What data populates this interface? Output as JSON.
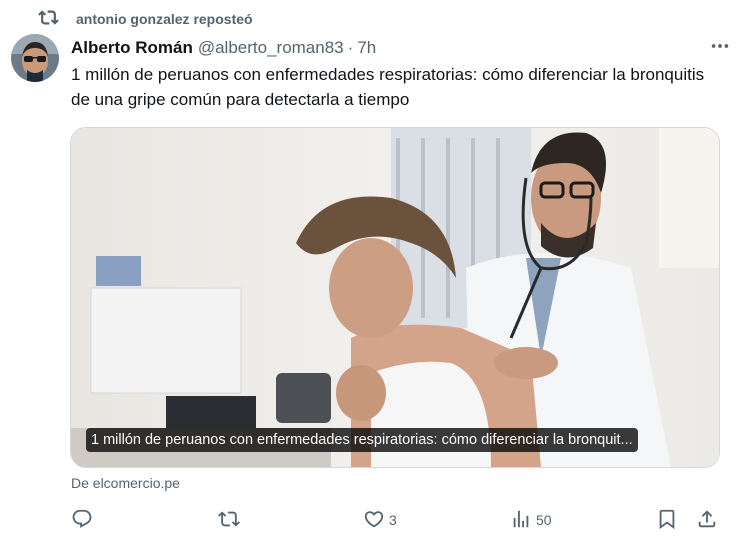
{
  "repost": {
    "text": "antonio gonzalez reposteó",
    "icon": "repost-icon"
  },
  "author": {
    "name": "Alberto Román",
    "handle": "@alberto_roman83",
    "separator": "·",
    "time": "7h"
  },
  "tweet": {
    "text": "1 millón de peruanos con enfermedades respiratorias: cómo diferenciar la bronquitis de una gripe común para detectarla a tiempo"
  },
  "card": {
    "caption": "1 millón de peruanos con enfermedades respiratorias: cómo diferenciar la bronquit..."
  },
  "source": "De elcomercio.pe",
  "actions": {
    "reply_count": "",
    "repost_count": "",
    "like_count": "3",
    "views_count": "50"
  },
  "colors": {
    "muted": "#536471",
    "text": "#0f1419",
    "border": "#cfd9de"
  }
}
